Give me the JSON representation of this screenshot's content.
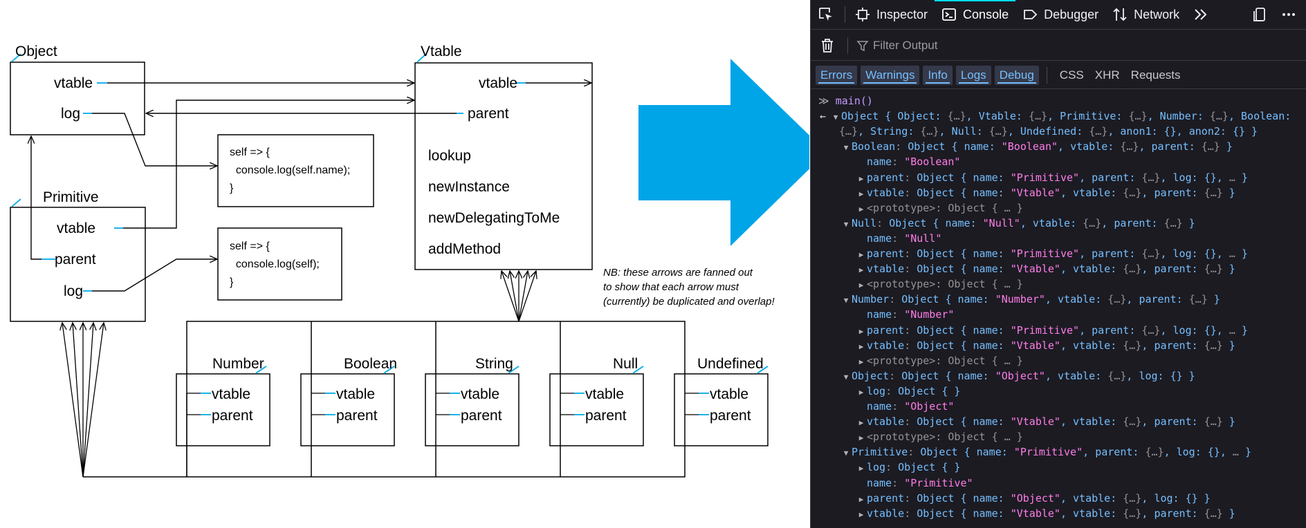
{
  "diagram": {
    "object": {
      "title": "Object",
      "fields": [
        "vtable",
        "log"
      ]
    },
    "vtable": {
      "title": "Vtable",
      "fields": [
        "vtable",
        "parent"
      ],
      "methods": [
        "lookup",
        "newInstance",
        "newDelegatingToMe",
        "addMethod"
      ]
    },
    "primitive": {
      "title": "Primitive",
      "fields": [
        "vtable",
        "parent",
        "log"
      ]
    },
    "code1": "self => {\n  console.log(self.name);\n}",
    "code2": "self => {\n  console.log(self);\n}",
    "note": "NB: these arrows are fanned out\nto show that each arrow must\n(currently) be duplicated and overlap!",
    "types": [
      {
        "title": "Number",
        "fields": [
          "vtable",
          "parent"
        ]
      },
      {
        "title": "Boolean",
        "fields": [
          "vtable",
          "parent"
        ]
      },
      {
        "title": "String",
        "fields": [
          "vtable",
          "parent"
        ]
      },
      {
        "title": "Null",
        "fields": [
          "vtable",
          "parent"
        ]
      },
      {
        "title": "Undefined",
        "fields": [
          "vtable",
          "parent"
        ]
      }
    ],
    "arrow_color": "#00a5e8"
  },
  "devtools": {
    "tabs": [
      {
        "label": "",
        "icon": "element-picker-icon"
      },
      {
        "label": "Inspector",
        "icon": "inspector-icon"
      },
      {
        "label": "Console",
        "icon": "console-icon",
        "active": true
      },
      {
        "label": "Debugger",
        "icon": "debugger-icon"
      },
      {
        "label": "Network",
        "icon": "network-icon"
      },
      {
        "label": "",
        "icon": "overflow-chevrons-icon"
      },
      {
        "label": "",
        "icon": "dock-icon"
      },
      {
        "label": "",
        "icon": "more-icon"
      }
    ],
    "filter_placeholder": "Filter Output",
    "levels": [
      "Errors",
      "Warnings",
      "Info",
      "Logs",
      "Debug"
    ],
    "requests": [
      "CSS",
      "XHR",
      "Requests"
    ],
    "input_command": "main()",
    "output": [
      {
        "depth": 0,
        "prefix": "←",
        "toggle": "open",
        "key": "",
        "summary": "Object { Object: {…}, Vtable: {…}, Primitive: {…}, Number: {…}, Boolean:"
      },
      {
        "depth": 0,
        "prefix": "",
        "toggle": "",
        "key": "",
        "summary": "{…}, String: {…}, Null: {…}, Undefined: {…}, anon1: {}, anon2: {} }"
      },
      {
        "depth": 1,
        "toggle": "open",
        "key": "Boolean",
        "summary": "Object { name: \"Boolean\", vtable: {…}, parent: {…} }"
      },
      {
        "depth": 2,
        "toggle": "",
        "key": "name",
        "string": "\"Boolean\""
      },
      {
        "depth": 2,
        "toggle": "closed",
        "key": "parent",
        "summary": "Object { name: \"Primitive\", parent: {…}, log: {}, … }"
      },
      {
        "depth": 2,
        "toggle": "closed",
        "key": "vtable",
        "summary": "Object { name: \"Vtable\", vtable: {…}, parent: {…} }"
      },
      {
        "depth": 2,
        "toggle": "closed",
        "key": "<prototype>",
        "summary": "Object { … }",
        "dim": true
      },
      {
        "depth": 1,
        "toggle": "open",
        "key": "Null",
        "summary": "Object { name: \"Null\", vtable: {…}, parent: {…} }"
      },
      {
        "depth": 2,
        "toggle": "",
        "key": "name",
        "string": "\"Null\""
      },
      {
        "depth": 2,
        "toggle": "closed",
        "key": "parent",
        "summary": "Object { name: \"Primitive\", parent: {…}, log: {}, … }"
      },
      {
        "depth": 2,
        "toggle": "closed",
        "key": "vtable",
        "summary": "Object { name: \"Vtable\", vtable: {…}, parent: {…} }"
      },
      {
        "depth": 2,
        "toggle": "closed",
        "key": "<prototype>",
        "summary": "Object { … }",
        "dim": true
      },
      {
        "depth": 1,
        "toggle": "open",
        "key": "Number",
        "summary": "Object { name: \"Number\", vtable: {…}, parent: {…} }"
      },
      {
        "depth": 2,
        "toggle": "",
        "key": "name",
        "string": "\"Number\""
      },
      {
        "depth": 2,
        "toggle": "closed",
        "key": "parent",
        "summary": "Object { name: \"Primitive\", parent: {…}, log: {}, … }"
      },
      {
        "depth": 2,
        "toggle": "closed",
        "key": "vtable",
        "summary": "Object { name: \"Vtable\", vtable: {…}, parent: {…} }"
      },
      {
        "depth": 2,
        "toggle": "closed",
        "key": "<prototype>",
        "summary": "Object { … }",
        "dim": true
      },
      {
        "depth": 1,
        "toggle": "open",
        "key": "Object",
        "summary": "Object { name: \"Object\", vtable: {…}, log: {} }"
      },
      {
        "depth": 2,
        "toggle": "closed",
        "key": "log",
        "summary": "Object {  }"
      },
      {
        "depth": 2,
        "toggle": "",
        "key": "name",
        "string": "\"Object\""
      },
      {
        "depth": 2,
        "toggle": "closed",
        "key": "vtable",
        "summary": "Object { name: \"Vtable\", vtable: {…}, parent: {…} }"
      },
      {
        "depth": 2,
        "toggle": "closed",
        "key": "<prototype>",
        "summary": "Object { … }",
        "dim": true
      },
      {
        "depth": 1,
        "toggle": "open",
        "key": "Primitive",
        "summary": "Object { name: \"Primitive\", parent: {…}, log: {}, … }"
      },
      {
        "depth": 2,
        "toggle": "closed",
        "key": "log",
        "summary": "Object {  }"
      },
      {
        "depth": 2,
        "toggle": "",
        "key": "name",
        "string": "\"Primitive\""
      },
      {
        "depth": 2,
        "toggle": "closed",
        "key": "parent",
        "summary": "Object { name: \"Object\", vtable: {…}, log: {} }"
      },
      {
        "depth": 2,
        "toggle": "closed",
        "key": "vtable",
        "summary": "Object { name: \"Vtable\", vtable: {…}, parent: {…} }"
      }
    ],
    "colors": {
      "background": "#1c1b22",
      "key": "#75bfff",
      "string": "#ff7de9",
      "accent": "#00ddff"
    }
  }
}
